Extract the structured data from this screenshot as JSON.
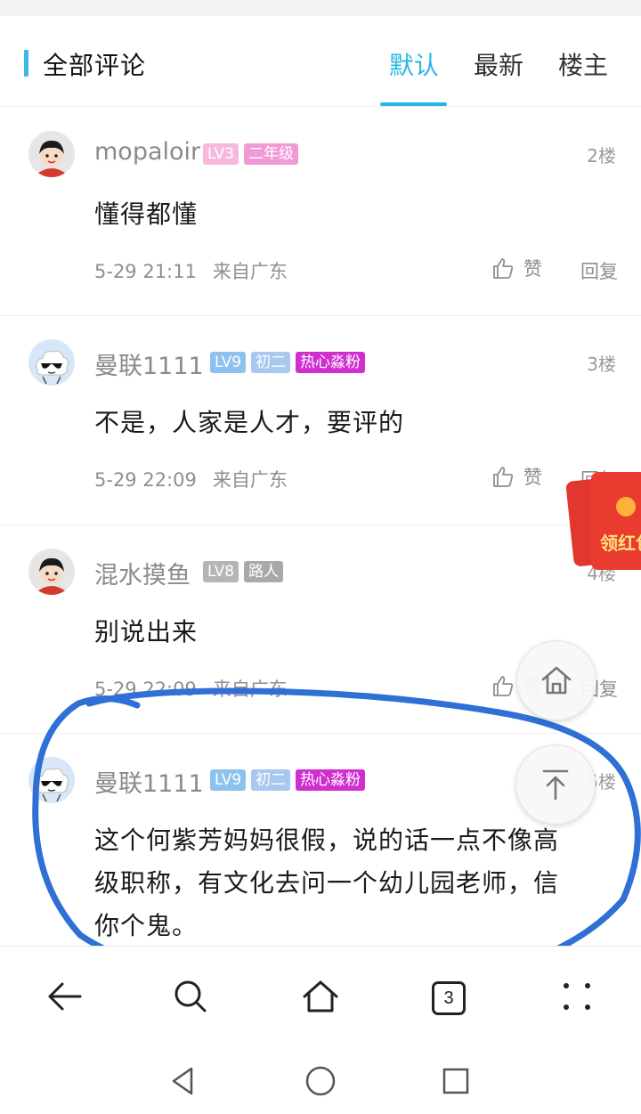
{
  "header": {
    "title": "全部评论",
    "tabs": [
      "默认",
      "最新",
      "楼主"
    ],
    "active_tab": "默认"
  },
  "comments": [
    {
      "user": "mopaloir",
      "badges": [
        {
          "text": "LV3",
          "color": "#f6b8dd"
        },
        {
          "text": "二年级",
          "color": "#f09ad6"
        }
      ],
      "floor": "2楼",
      "text": "懂得都懂",
      "time": "5-29 21:11",
      "source": "来自广东",
      "like_label": "赞",
      "reply_label": "回复",
      "avatar": "kid-avatar-icon"
    },
    {
      "user": "曼联1111",
      "badges": [
        {
          "text": "LV9",
          "color": "#8ec2ee"
        },
        {
          "text": "初二",
          "color": "#a8c8ef"
        },
        {
          "text": "热心淼粉",
          "color": "#d02fd0"
        }
      ],
      "floor": "3楼",
      "text": "不是，人家是人才，要评的",
      "time": "5-29 22:09",
      "source": "来自广东",
      "like_label": "赞",
      "reply_label": "回复",
      "avatar": "cloud-sunglasses-avatar-icon"
    },
    {
      "user": "混水摸鱼",
      "badges": [
        {
          "text": "LV8",
          "color": "#b5b5b5"
        },
        {
          "text": "路人",
          "color": "#a9a9a9"
        }
      ],
      "floor": "4楼",
      "text": "别说出来",
      "time": "5-29 22:09",
      "source": "来自广东",
      "like_label": "赞",
      "reply_label": "回复",
      "avatar": "kid-avatar-icon"
    },
    {
      "user": "曼联1111",
      "badges": [
        {
          "text": "LV9",
          "color": "#8ec2ee"
        },
        {
          "text": "初二",
          "color": "#a8c8ef"
        },
        {
          "text": "热心淼粉",
          "color": "#d02fd0"
        }
      ],
      "floor": "5楼",
      "text_lines": [
        "这个何紫芳妈妈很假，说的话一点不像高",
        "级职称，有文化去问一个幼儿园老师，信",
        "你个鬼。"
      ],
      "avatar": "cloud-sunglasses-avatar-icon"
    }
  ],
  "floating": {
    "red_packet_label": "领红包",
    "home_icon": "home-icon",
    "top_icon": "back-to-top-icon"
  },
  "toolbar": {
    "tab_count": "3",
    "icons": [
      "back-arrow-icon",
      "search-icon",
      "home-icon",
      "tabs-icon",
      "more-dots-icon"
    ]
  },
  "system_nav": {
    "icons": [
      "nav-back-triangle-icon",
      "nav-home-circle-icon",
      "nav-recents-square-icon"
    ]
  },
  "colors": {
    "accent": "#27b7e6",
    "annotation_stroke": "#2f6fd6"
  }
}
